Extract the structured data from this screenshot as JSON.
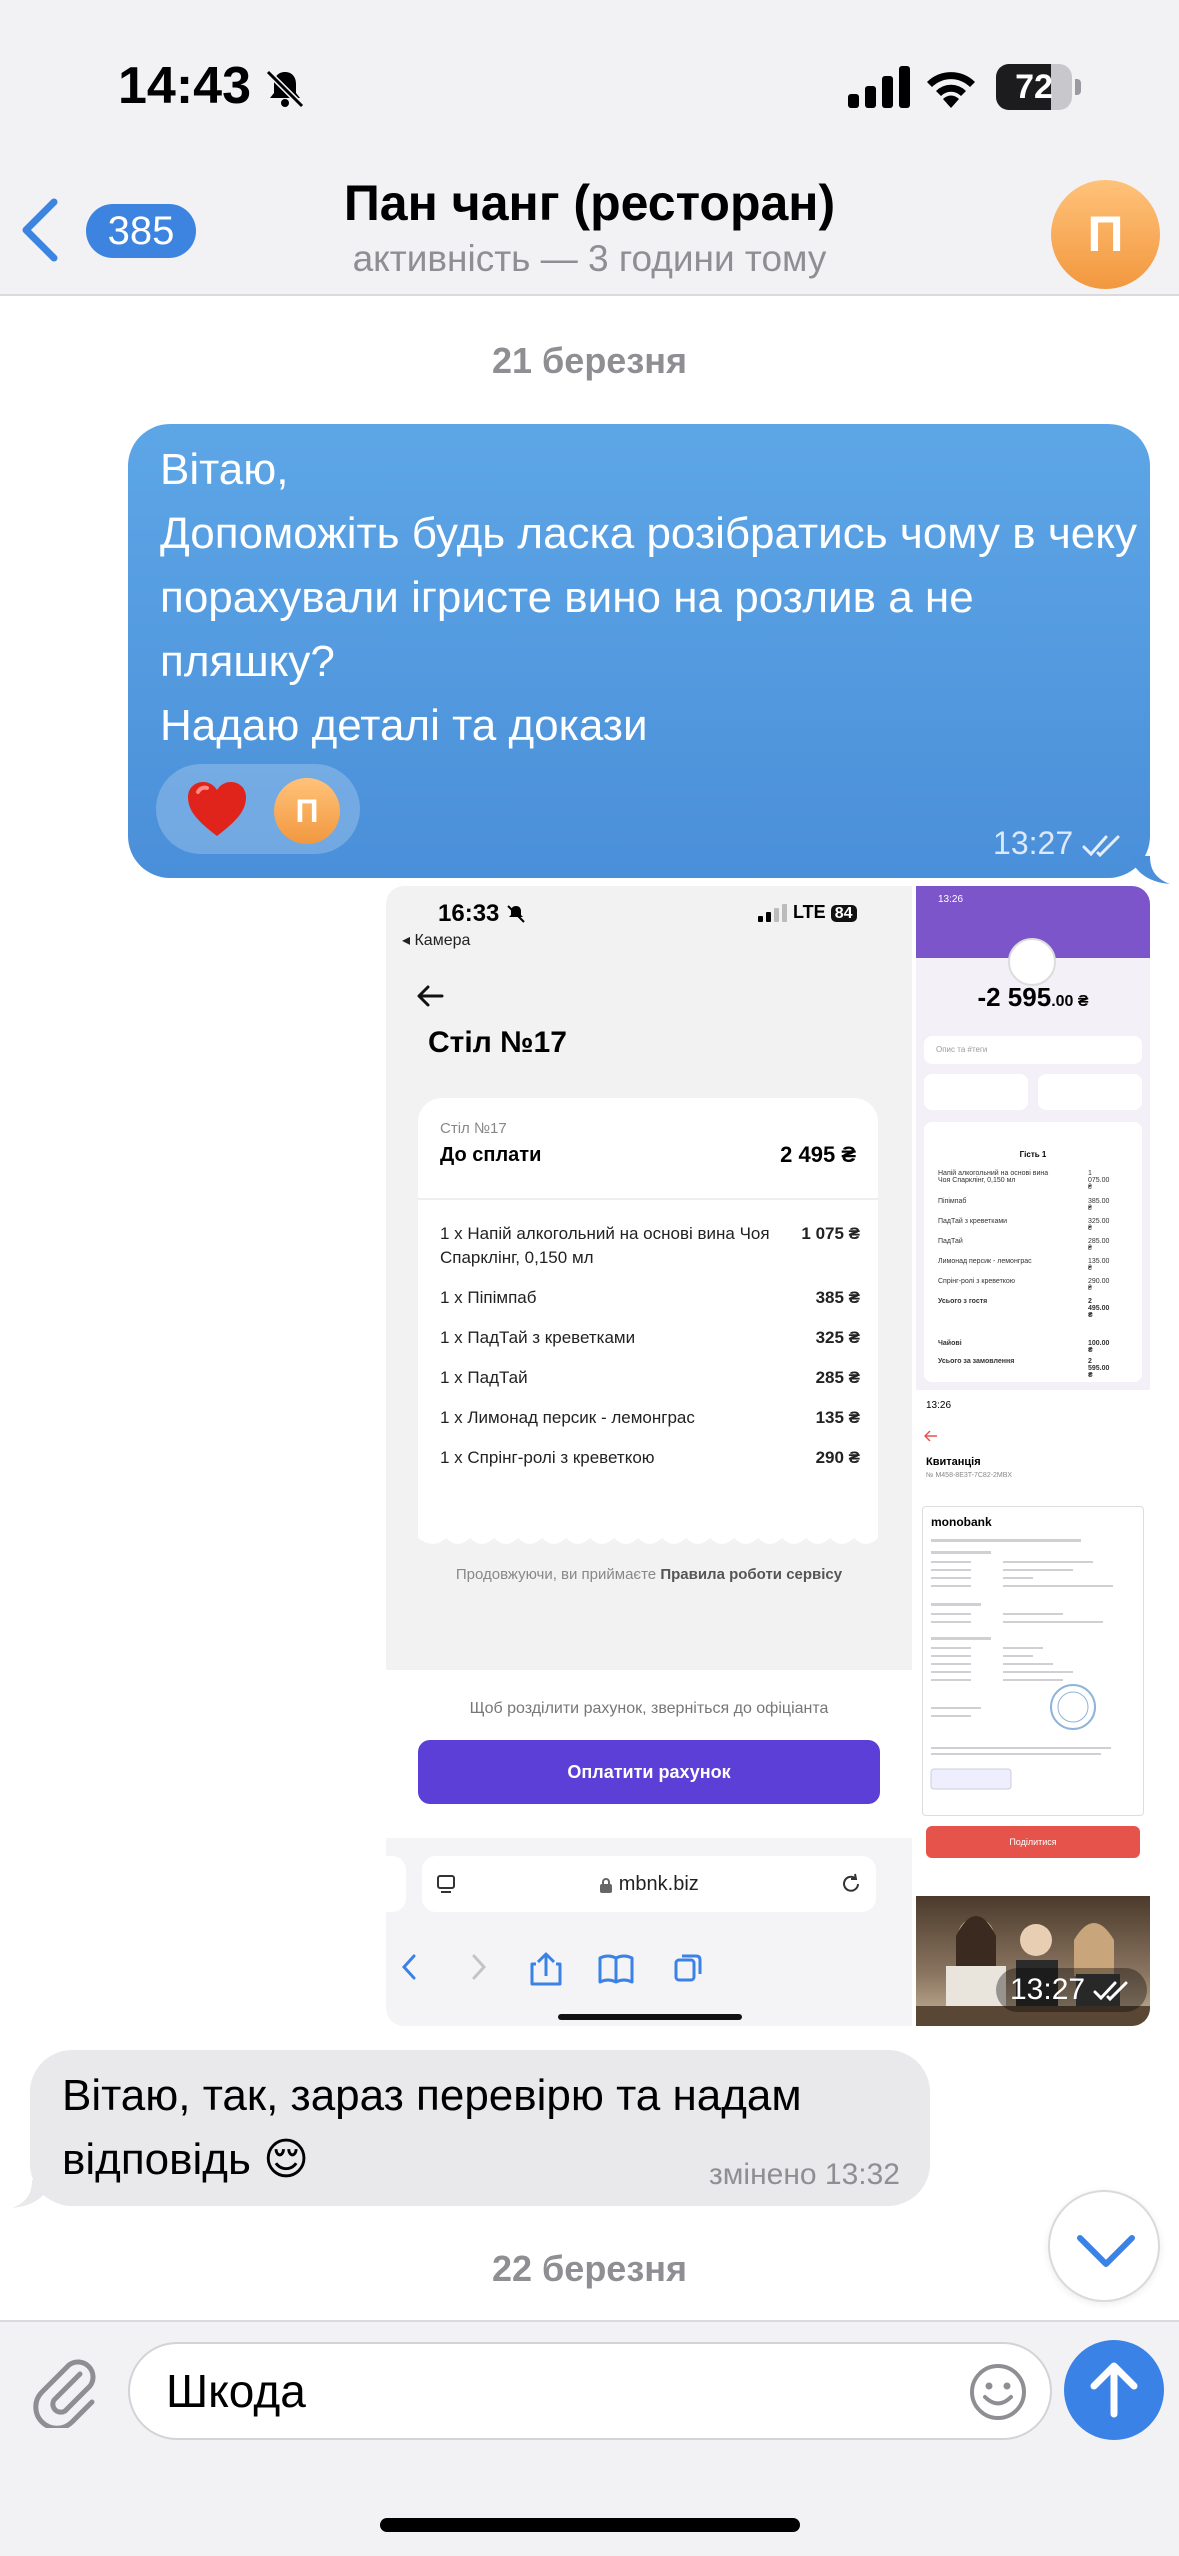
{
  "status_bar": {
    "time": "14:43",
    "battery": "72",
    "battery_level": 0.72
  },
  "header": {
    "back_count": "385",
    "title": "Пан чанг (ресторан)",
    "subtitle": "активність — 3 години тому",
    "avatar_letter": "П"
  },
  "chat": {
    "date_1": "21 березня",
    "message_out": {
      "text": "Вітаю,\nДопоможіть будь ласка розібратись чому в чеку порахували ігристе вино на розлив а не пляшку?\nНадаю деталі та докази",
      "time": "13:27",
      "reaction_avatar": "П"
    },
    "media": {
      "time": "13:27",
      "shot1": {
        "time": "16:33",
        "back_app": "◂ Камера",
        "network": "LTE",
        "battery": "84",
        "title": "Стіл №17",
        "receipt_small": "Стіл №17",
        "due_label": "До сплати",
        "due_sum": "2 495 ₴",
        "items": [
          {
            "name": "1 х Напій алкогольний на основі вина Чоя Спарклінг, 0,150 мл",
            "price": "1 075 ₴"
          },
          {
            "name": "1 х Піпімпаб",
            "price": "385 ₴"
          },
          {
            "name": "1 х ПадТай з креветками",
            "price": "325 ₴"
          },
          {
            "name": "1 х ПадТай",
            "price": "285 ₴"
          },
          {
            "name": "1 х Лимонад персик - лемонграс",
            "price": "135 ₴"
          },
          {
            "name": "1 х Спрінг-ролі з креветкою",
            "price": "290 ₴"
          }
        ],
        "agree_prefix": "Продовжуючи, ви приймаєте ",
        "agree_link": "Правила роботи сервісу",
        "split_hint": "Щоб розділити рахунок, зверніться до офіціанта",
        "pay_button": "Оплатити рахунок",
        "url": "mbnk.biz"
      },
      "shot2": {
        "time": "13:26",
        "amount": "-2 595",
        "amount_dec": ".00 ₴",
        "search": "Опис та #теги",
        "guest": "Гість 1",
        "lines": [
          {
            "name": "Напій алкогольний на основі вина Чоя Спарклінг, 0,150 мл",
            "price": "1 075.00 ₴"
          },
          {
            "name": "Піпімпаб",
            "price": "385.00 ₴"
          },
          {
            "name": "ПадТай з креветками",
            "price": "325.00 ₴"
          },
          {
            "name": "ПадТай",
            "price": "285.00 ₴"
          },
          {
            "name": "Лимонад персик - лемонграс",
            "price": "135.00 ₴"
          },
          {
            "name": "Спрінг-ролі з креветкою",
            "price": "290.00 ₴"
          },
          {
            "name": "Усього з гостя",
            "price": "2 495.00 ₴"
          }
        ],
        "tips": "Чайові",
        "tips_price": "100.00 ₴",
        "total": "Усього за замовлення",
        "total_price": "2 595.00 ₴"
      },
      "shot3": {
        "time": "13:26",
        "title": "Квитанція",
        "bank": "monobank",
        "share": "Поділитися"
      }
    },
    "message_in": {
      "text": "Вітаю, так, зараз перевірю та надам відповідь 😌",
      "meta": "змінено 13:32"
    },
    "date_2": "22 березня"
  },
  "composer": {
    "text": "Шкода"
  },
  "colors": {
    "accent": "#3b82e6",
    "bubble_out": "#4a8fd9",
    "avatar": "#f2983f",
    "pay_button": "#5c3fd6"
  }
}
